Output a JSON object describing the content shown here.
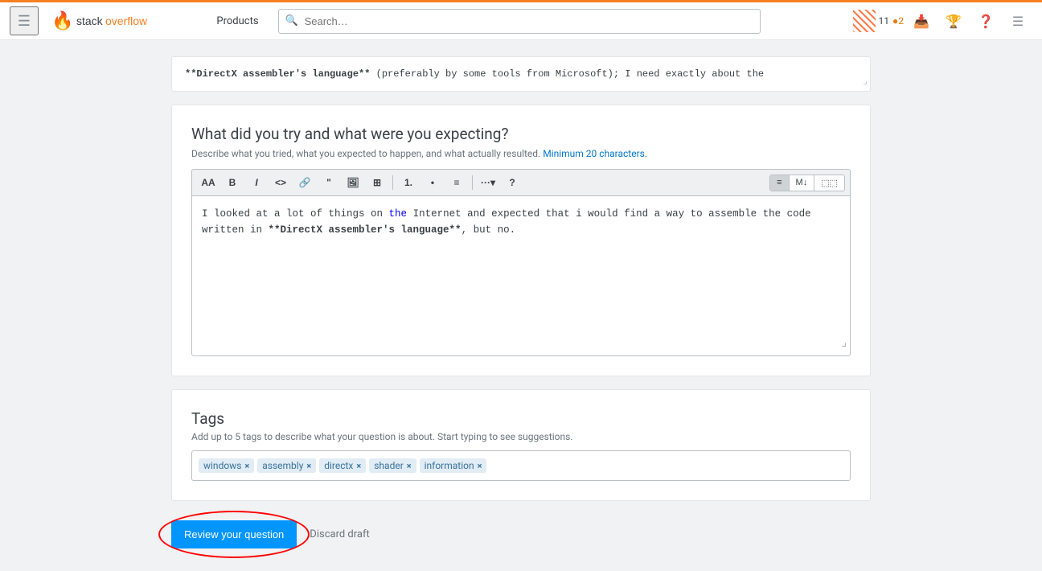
{
  "navbar": {
    "hamburger_label": "☰",
    "logo_text": "stack overflow",
    "products_label": "Products",
    "search_placeholder": "Search…",
    "rep": "11",
    "rep_badge": "●2",
    "inbox_icon": "💬",
    "achievements_icon": "🏆",
    "help_icon": "?",
    "reviews_icon": "≡"
  },
  "top_card": {
    "text": "**DirectX assembler's language** (preferably by some tools from Microsoft); I need exactly about the"
  },
  "what_section": {
    "title": "What did you try and what were you expecting?",
    "hint": "Describe what you tried, what you expected to happen, and what actually resulted.",
    "hint_min": " Minimum 20 characters.",
    "toolbar": {
      "btns": [
        {
          "label": "AA",
          "name": "text-size-btn"
        },
        {
          "label": "B",
          "name": "bold-btn"
        },
        {
          "label": "I",
          "name": "italic-btn"
        },
        {
          "label": "<>",
          "name": "code-btn"
        },
        {
          "label": "🔗",
          "name": "link-btn"
        },
        {
          "label": "\"",
          "name": "quote-btn"
        },
        {
          "label": "🖼",
          "name": "image-btn"
        },
        {
          "label": "⊞",
          "name": "table-btn"
        },
        {
          "label": "1.",
          "name": "ordered-list-btn"
        },
        {
          "label": "•",
          "name": "unordered-list-btn"
        },
        {
          "label": "≡",
          "name": "align-btn"
        },
        {
          "label": "···",
          "name": "more-btn"
        },
        {
          "label": "?",
          "name": "help-btn"
        }
      ],
      "view_btns": [
        {
          "label": "≡",
          "name": "text-view-btn",
          "active": true
        },
        {
          "label": "M↓",
          "name": "markdown-view-btn",
          "active": false
        },
        {
          "label": "⬚⬚",
          "name": "split-view-btn",
          "active": false
        }
      ]
    },
    "editor_lines": [
      "I looked at a lot of things on the Internet and expected that i would find a way to assemble the code",
      "written in **DirectX assembler's language**, but no."
    ]
  },
  "tags_section": {
    "title": "Tags",
    "hint": "Add up to 5 tags to describe what your question is about. Start typing to see suggestions.",
    "tags": [
      {
        "label": "windows",
        "name": "tag-windows"
      },
      {
        "label": "assembly",
        "name": "tag-assembly"
      },
      {
        "label": "directx",
        "name": "tag-directx"
      },
      {
        "label": "shader",
        "name": "tag-shader"
      },
      {
        "label": "information",
        "name": "tag-information"
      }
    ]
  },
  "actions": {
    "review_label": "Review your question",
    "discard_label": "Discard draft"
  }
}
